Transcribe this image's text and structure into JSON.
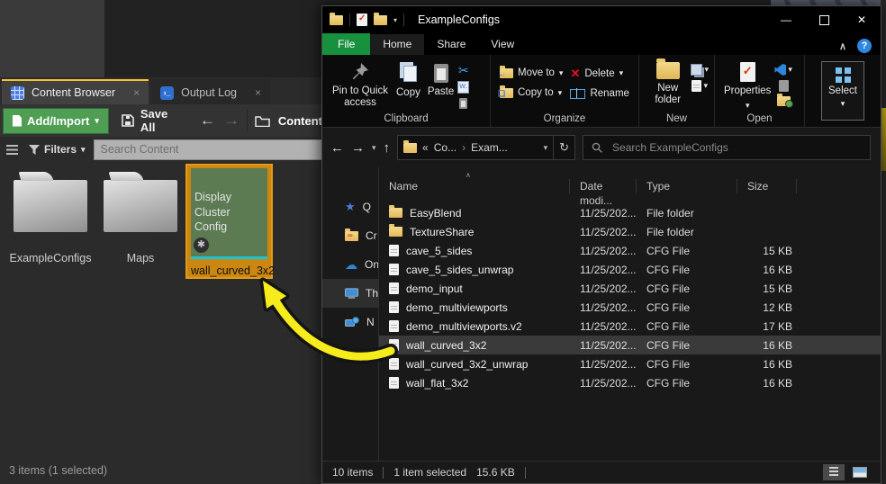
{
  "colors": {
    "ue_accent_green": "#4f9e53",
    "ue_tab_highlight": "#f1c232",
    "selection_orange": "#cb8712",
    "thumb_green": "#5d7b52",
    "thumb_cyan": "#18c5d8",
    "arrow_yellow": "#f6ec1c",
    "explorer_file_tab_green": "#18913f",
    "delete_red": "#e81123"
  },
  "icons": {
    "close": "✕",
    "minimize": "—",
    "help": "?",
    "back": "←",
    "forward": "→",
    "up": "↑",
    "refresh": "↻",
    "caret_down": "▾",
    "chevron_up": "∧",
    "sort_asc": "∧",
    "crumb_overflow": "«",
    "crumb_sep": "›",
    "cut": "✂",
    "delete_x": "✕",
    "star": "★",
    "cloud": "☁",
    "asterisk_badge": "✱",
    "tab_close": "×"
  },
  "ue": {
    "tabs": [
      {
        "label": "Content Browser"
      },
      {
        "label": "Output Log"
      }
    ],
    "toolbar": {
      "add_import": "Add/Import",
      "save_all": "Save All",
      "breadcrumb": "Content"
    },
    "filter_bar": {
      "filters_label": "Filters",
      "search_placeholder": "Search Content"
    },
    "assets": [
      {
        "kind": "folder",
        "label": "ExampleConfigs"
      },
      {
        "kind": "folder",
        "label": "Maps"
      },
      {
        "kind": "display-cluster-config",
        "label": "wall_curved_3x2",
        "thumb_text": "Display Cluster Config"
      }
    ],
    "status": "3 items (1 selected)"
  },
  "explorer": {
    "title": "ExampleConfigs",
    "ribbon_tabs": [
      {
        "label": "File"
      },
      {
        "label": "Home"
      },
      {
        "label": "Share"
      },
      {
        "label": "View"
      }
    ],
    "ribbon": {
      "clipboard": {
        "group": "Clipboard",
        "pin": "Pin to Quick access",
        "copy": "Copy",
        "paste": "Paste"
      },
      "organize": {
        "group": "Organize",
        "move_to": "Move to",
        "copy_to": "Copy to",
        "del": "Delete",
        "rename": "Rename"
      },
      "new_grp": {
        "group": "New",
        "new_folder": "New folder"
      },
      "open_grp": {
        "group": "Open",
        "properties": "Properties"
      },
      "select_grp": {
        "label": "Select"
      }
    },
    "address_bar": {
      "crumbs": [
        "Co...",
        "Exam..."
      ],
      "search_placeholder": "Search ExampleConfigs"
    },
    "nav_pane": [
      {
        "name": "quick-access",
        "label": "Q"
      },
      {
        "name": "creative-cloud",
        "label": "Cr"
      },
      {
        "name": "onedrive",
        "label": "On"
      },
      {
        "name": "this-pc",
        "label": "Th",
        "selected": true
      },
      {
        "name": "network",
        "label": "N"
      }
    ],
    "columns": [
      {
        "label": "Name"
      },
      {
        "label": "Date modi..."
      },
      {
        "label": "Type"
      },
      {
        "label": "Size"
      }
    ],
    "files": [
      {
        "name": "EasyBlend",
        "date": "11/25/202...",
        "type": "File folder",
        "size": ""
      },
      {
        "name": "TextureShare",
        "date": "11/25/202...",
        "type": "File folder",
        "size": ""
      },
      {
        "name": "cave_5_sides",
        "date": "11/25/202...",
        "type": "CFG File",
        "size": "15 KB"
      },
      {
        "name": "cave_5_sides_unwrap",
        "date": "11/25/202...",
        "type": "CFG File",
        "size": "16 KB"
      },
      {
        "name": "demo_input",
        "date": "11/25/202...",
        "type": "CFG File",
        "size": "15 KB"
      },
      {
        "name": "demo_multiviewports",
        "date": "11/25/202...",
        "type": "CFG File",
        "size": "12 KB"
      },
      {
        "name": "demo_multiviewports.v2",
        "date": "11/25/202...",
        "type": "CFG File",
        "size": "17 KB"
      },
      {
        "name": "wall_curved_3x2",
        "date": "11/25/202...",
        "type": "CFG File",
        "size": "16 KB",
        "selected": true
      },
      {
        "name": "wall_curved_3x2_unwrap",
        "date": "11/25/202...",
        "type": "CFG File",
        "size": "16 KB"
      },
      {
        "name": "wall_flat_3x2",
        "date": "11/25/202...",
        "type": "CFG File",
        "size": "16 KB"
      }
    ],
    "status_bar": {
      "items": "10 items",
      "selected": "1 item selected",
      "size": "15.6 KB"
    }
  }
}
